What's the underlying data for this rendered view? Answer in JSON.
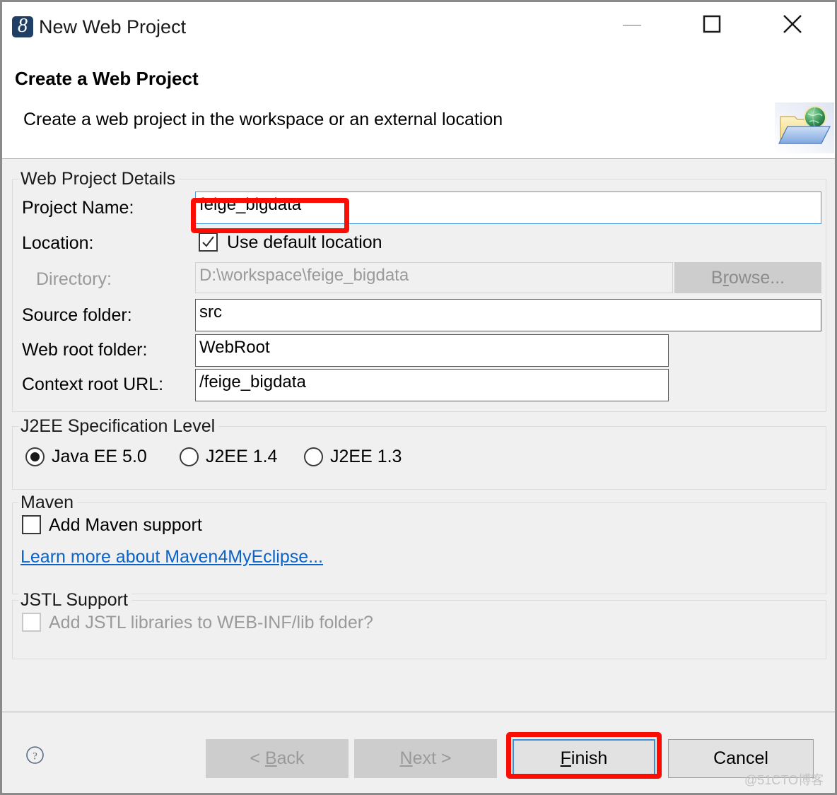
{
  "window": {
    "title": "New Web Project",
    "app_icon": "myeclipse-icon",
    "controls": {
      "minimize": "minimize-icon",
      "maximize": "maximize-icon",
      "close": "close-icon"
    }
  },
  "header": {
    "title": "Create a Web Project",
    "description": "Create a web project in the workspace or an external location",
    "graphic": "folder-globe-icon"
  },
  "form": {
    "details_group": {
      "legend": "Web Project Details",
      "project_name_label": "Project Name:",
      "project_name_value": "feige_bigdata",
      "location_label": "Location:",
      "use_default_location_label": "Use default location",
      "use_default_location_checked": true,
      "directory_label": "Directory:",
      "directory_value": "D:\\workspace\\feige_bigdata",
      "directory_enabled": false,
      "browse_label": "Browse...",
      "browse_mnemonic": "r",
      "browse_enabled": false,
      "source_folder_label": "Source folder:",
      "source_folder_value": "src",
      "web_root_folder_label": "Web root folder:",
      "web_root_folder_value": "WebRoot",
      "context_root_label": "Context root URL:",
      "context_root_value": "/feige_bigdata"
    },
    "j2ee_group": {
      "legend": "J2EE Specification Level",
      "options": [
        {
          "label": "Java EE 5.0",
          "selected": true
        },
        {
          "label": "J2EE 1.4",
          "selected": false
        },
        {
          "label": "J2EE 1.3",
          "selected": false
        }
      ]
    },
    "maven_group": {
      "legend": "Maven",
      "add_maven_label": "Add Maven support",
      "add_maven_checked": false,
      "link_label": "Learn more about Maven4MyEclipse..."
    },
    "jstl_group": {
      "legend": "JSTL Support",
      "add_jstl_label": "Add JSTL libraries to WEB-INF/lib folder?",
      "add_jstl_checked": false,
      "add_jstl_enabled": false
    }
  },
  "footer": {
    "help_icon": "help-question-icon",
    "buttons": [
      {
        "name": "back",
        "prefix": "< ",
        "mnemonic": "B",
        "suffix": "ack",
        "enabled": false
      },
      {
        "name": "next",
        "prefix": "",
        "mnemonic": "N",
        "suffix": "ext >",
        "enabled": false
      },
      {
        "name": "finish",
        "prefix": "",
        "mnemonic": "F",
        "suffix": "inish",
        "enabled": true
      },
      {
        "name": "cancel",
        "prefix": "",
        "mnemonic": "",
        "suffix": "Cancel",
        "enabled": true
      }
    ]
  },
  "annotations": {
    "color": "#fb0d04",
    "targets": [
      "project-name-value",
      "finish-button"
    ]
  },
  "watermark": "@51CTO博客"
}
